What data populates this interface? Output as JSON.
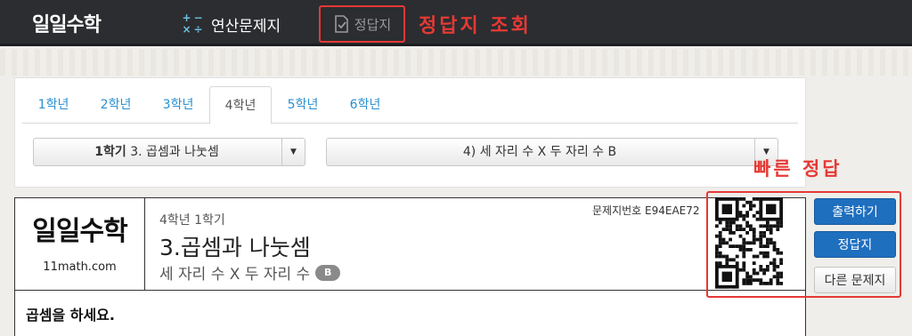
{
  "header": {
    "logo": "일일수학",
    "nav_calc_label": "연산문제지",
    "nav_answer_label": "정답지",
    "annotation_answer_lookup": "정답지 조회"
  },
  "tabs": [
    "1학년",
    "2학년",
    "3학년",
    "4학년",
    "5학년",
    "6학년"
  ],
  "active_tab": "4학년",
  "selects": {
    "semester_bold": "1학기",
    "semester_unit": " 3. 곱셈과 나눗셈",
    "topic": "4) 세 자리 수 X 두 자리 수 B"
  },
  "sheet": {
    "logo_text": "일일수학",
    "logo_url_text": "11math.com",
    "grade_line": "4학년 1학기",
    "unit_title": "3.곱셈과 나눗셈",
    "sub_title": "세 자리 수 X 두 자리 수",
    "level_badge": "B",
    "sheet_number": "문제지번호 E94EAE72",
    "instruction": "곱셈을 하세요."
  },
  "quick": {
    "annotation": "빠른 정답",
    "print_label": "출력하기",
    "answer_label": "정답지",
    "other_label": "다른 문제지"
  },
  "colors": {
    "accent_red": "#e53935",
    "tab_blue": "#2a8fd0",
    "button_blue": "#1f6fbf",
    "topbar": "#2b2d30"
  }
}
